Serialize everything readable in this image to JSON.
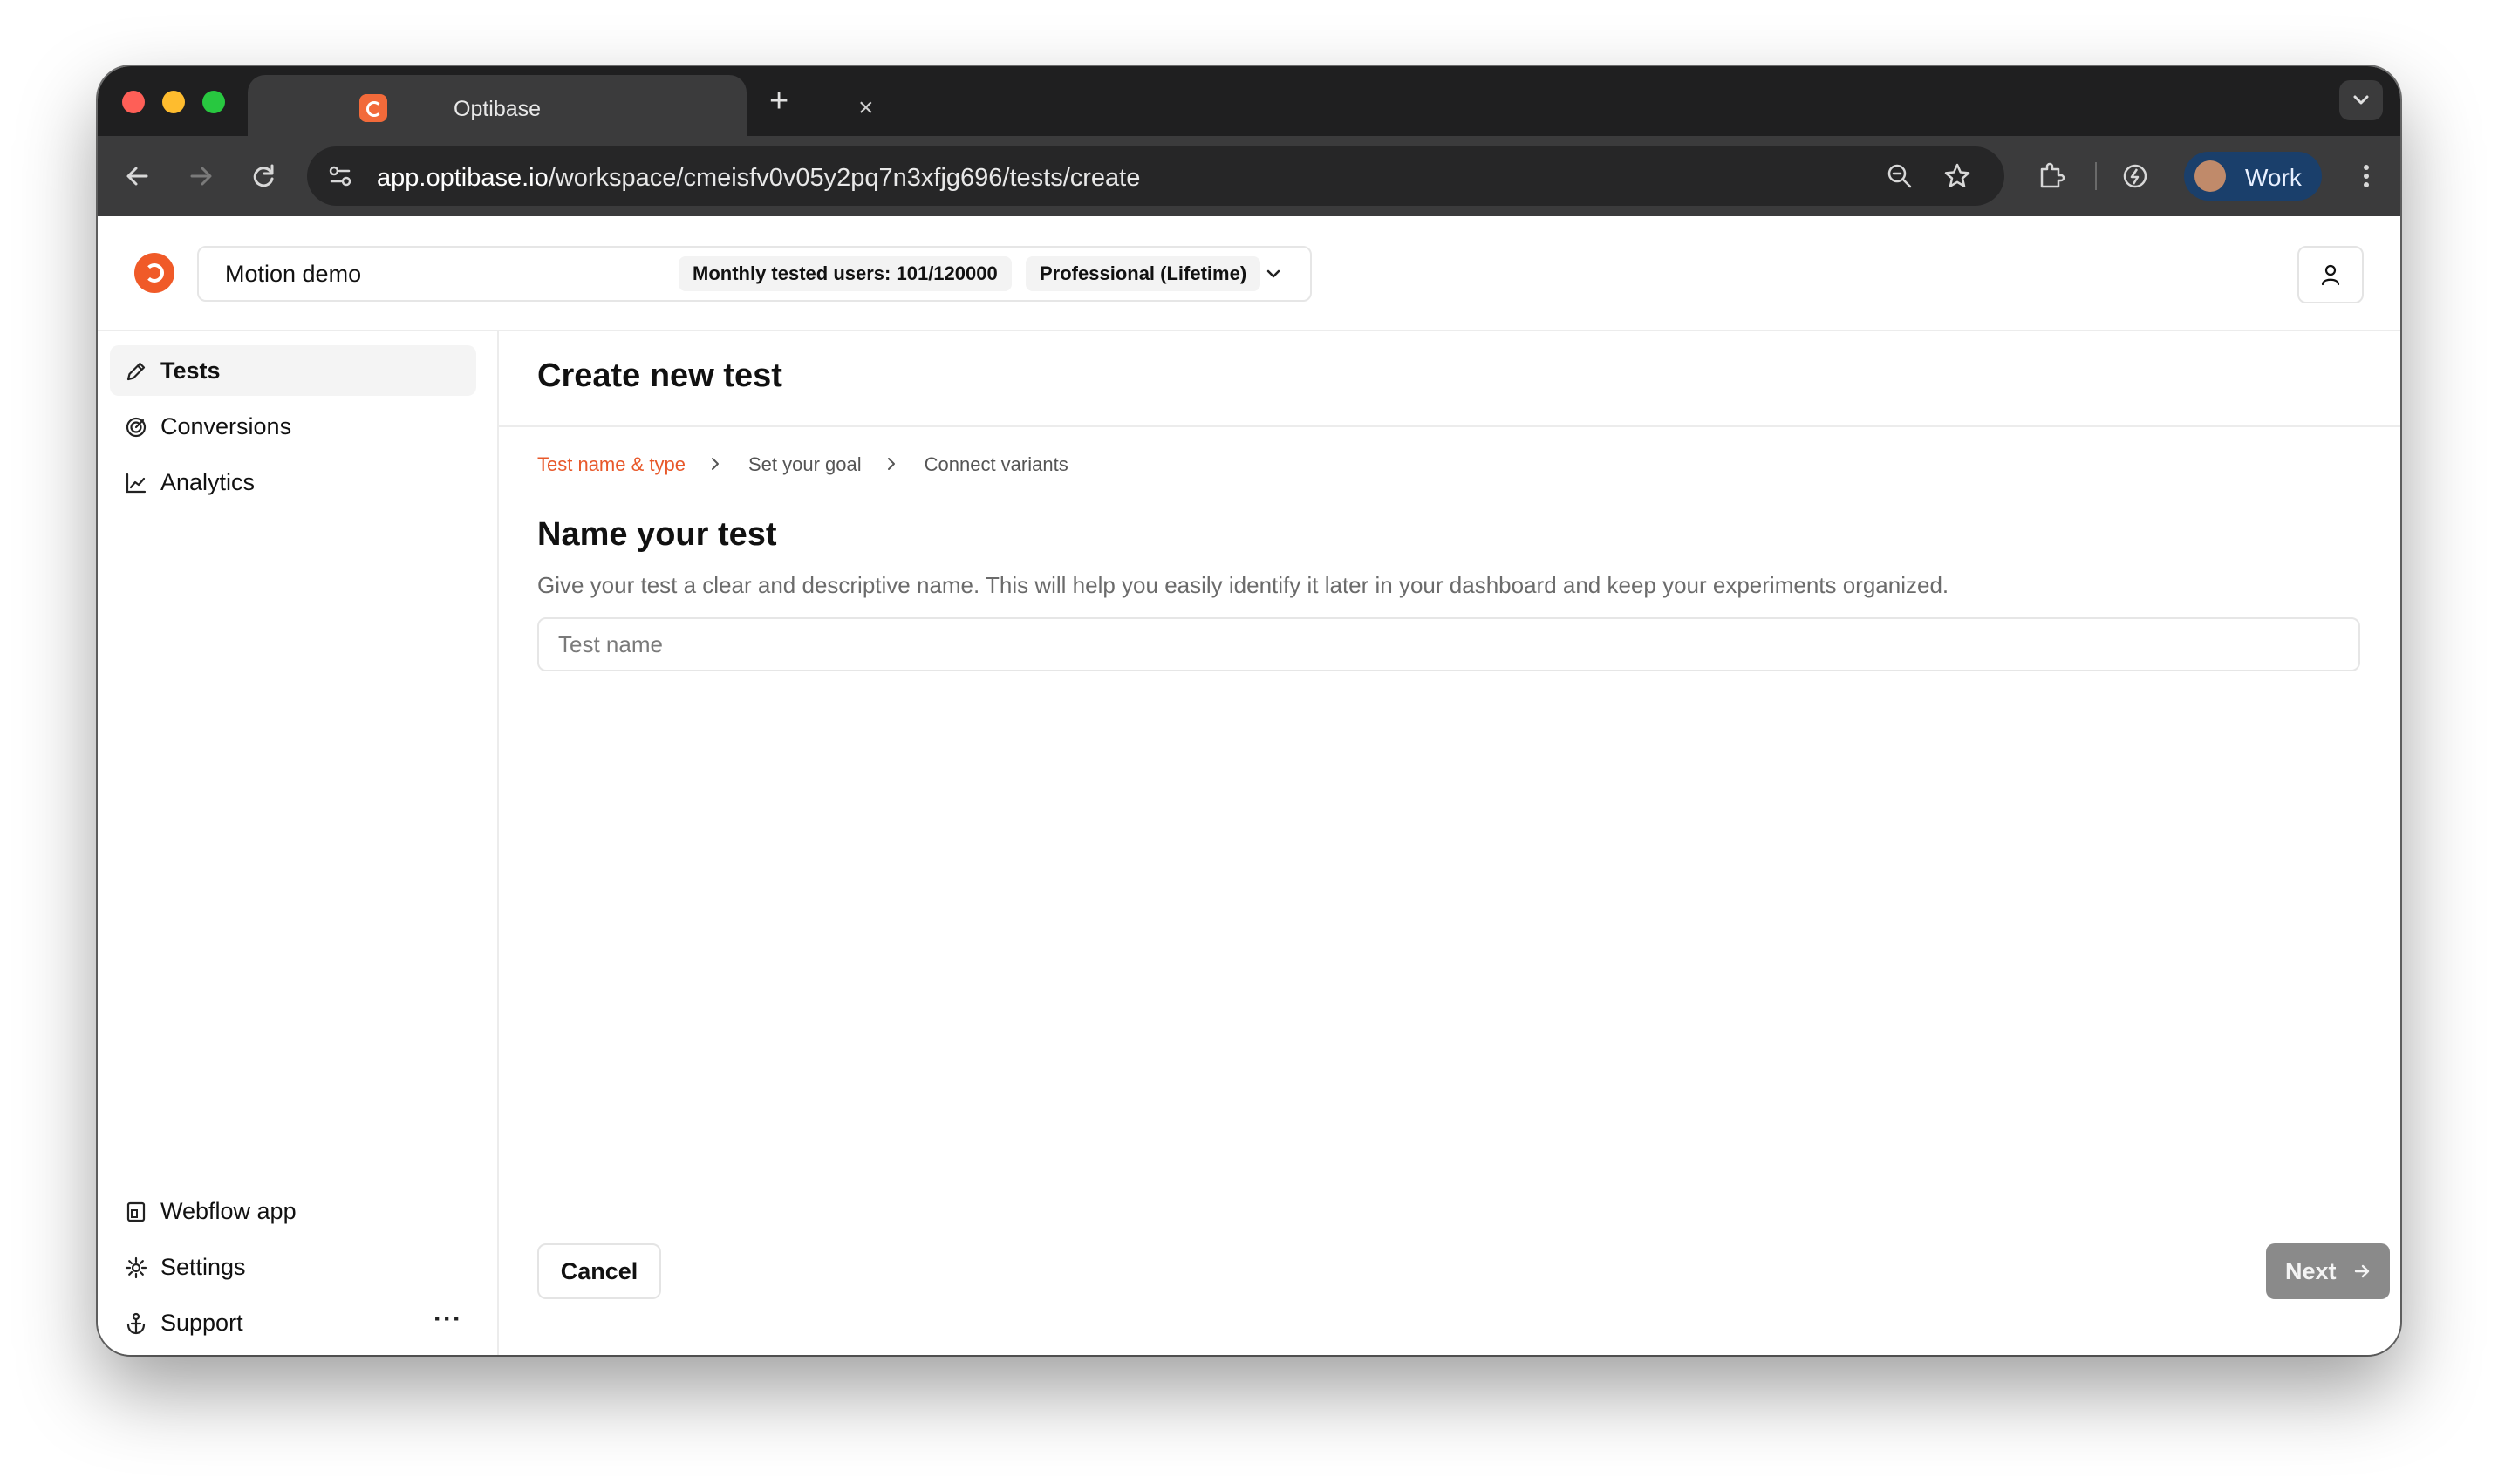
{
  "browser": {
    "tab_title": "Optibase",
    "tab_close": "×",
    "new_tab": "+",
    "url_host": "app.optibase.io",
    "url_path": "/workspace/cmeisfv0v05y2pq7n3xfjg696/tests/create",
    "profile_label": "Work"
  },
  "header": {
    "workspace_name": "Motion demo",
    "monthly_users": "Monthly tested users: 101/120000",
    "plan": "Professional (Lifetime)"
  },
  "sidebar": {
    "items": [
      {
        "label": "Tests",
        "icon": "pencil-icon"
      },
      {
        "label": "Conversions",
        "icon": "target-icon"
      },
      {
        "label": "Analytics",
        "icon": "line-chart-icon"
      }
    ],
    "bottom_items": [
      {
        "label": "Webflow app",
        "icon": "webflow-icon"
      },
      {
        "label": "Settings",
        "icon": "gear-icon"
      },
      {
        "label": "Support",
        "icon": "anchor-icon"
      }
    ],
    "more": "···"
  },
  "main": {
    "title": "Create new test",
    "steps": [
      "Test name & type",
      "Set your goal",
      "Connect variants"
    ],
    "section_title": "Name your test",
    "section_description": "Give your test a clear and descriptive name. This will help you easily identify it later in your dashboard and keep your experiments organized.",
    "input_placeholder": "Test name",
    "cancel_label": "Cancel",
    "next_label": "Next"
  },
  "colors": {
    "accent": "#e8582a",
    "tab_strip": "#1f1f20",
    "toolbar": "#3b3b3c",
    "next_disabled": "#8a8a8a"
  }
}
